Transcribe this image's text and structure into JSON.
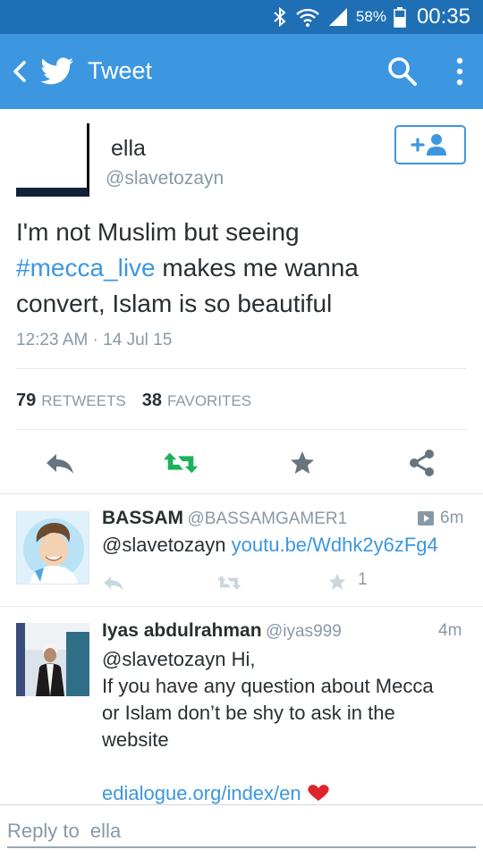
{
  "status_bar": {
    "battery_percent": "58%",
    "time": "00:35",
    "icons": [
      "bluetooth-icon",
      "wifi-icon",
      "signal-icon",
      "battery-icon"
    ]
  },
  "app_bar": {
    "title": "Tweet",
    "icons": [
      "back-icon",
      "twitter-bird-icon",
      "search-icon",
      "overflow-menu-icon"
    ],
    "background": "#3c97e0"
  },
  "tweet": {
    "author_name": "ella",
    "author_handle": "@slavetozayn",
    "text_parts": {
      "line1": "I'm not Muslim but seeing",
      "hashtag": "#mecca_live",
      "after_hashtag": " makes me wanna",
      "line3": "convert, Islam is so beautiful"
    },
    "timestamp": "12:23 AM · 14 Jul 15",
    "retweets_count": "79",
    "retweets_label": "RETWEETS",
    "favorites_count": "38",
    "favorites_label": "FAVORITES",
    "follow_icon": "add-user-icon"
  },
  "replies": [
    {
      "name": "BASSAM",
      "handle": "@BASSAMGAMER1",
      "time": "6m",
      "has_video": true,
      "mention": "@slavetozayn",
      "link": "youtu.be/Wdhk2y6zFg4",
      "favorites": "1"
    },
    {
      "name": "Iyas abdulrahman",
      "handle": "@iyas999",
      "time": "4m",
      "mention": "@slavetozayn",
      "greeting": " Hi,",
      "line2": "If you have any question about Mecca",
      "line3": "or Islam don’t be shy to ask in the",
      "line4": "website",
      "link": "edialogue.org/index/en"
    }
  ],
  "reply_bar": {
    "placeholder": "Reply to  ella"
  },
  "colors": {
    "accent": "#3c97e0",
    "retweet_green": "#19b35a",
    "muted": "#8899a6",
    "heart_red": "#e0242b"
  }
}
